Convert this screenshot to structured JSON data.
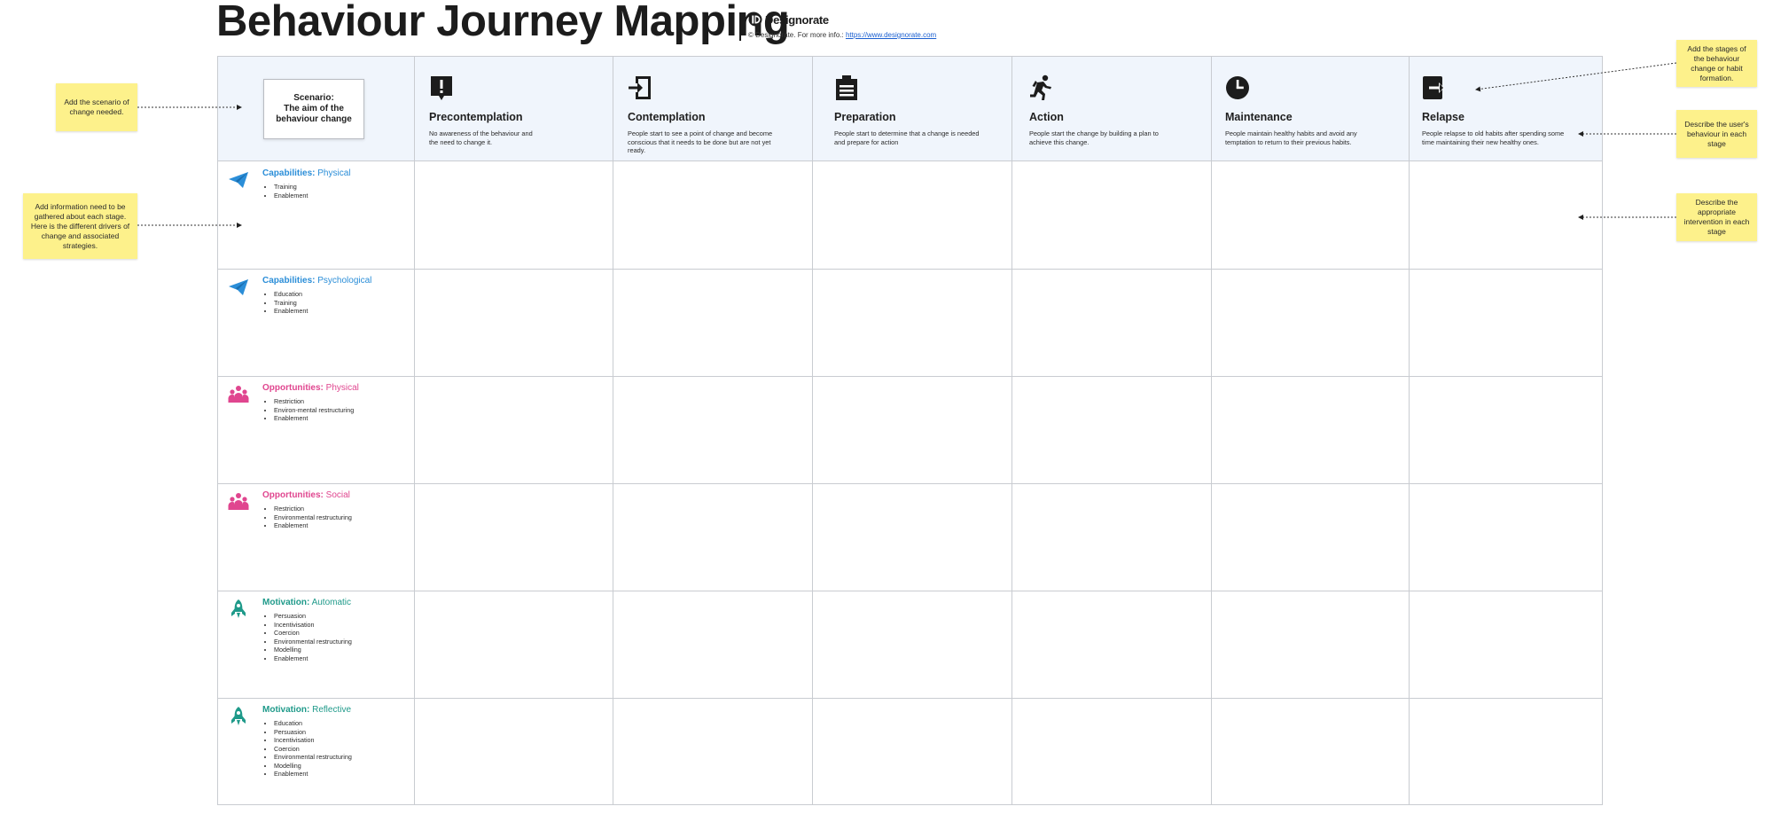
{
  "header": {
    "title": "Behaviour Journey Mapping",
    "brand_name": "Designorate",
    "copyright_text": "© Designorate. For more info.: ",
    "copyright_link": "https://www.designorate.com"
  },
  "scenario": {
    "label": "Scenario:",
    "text": "The aim of the behaviour change"
  },
  "stages": [
    {
      "name": "Precontemplation",
      "icon": "exclamation-bubble-icon",
      "description": "No awareness of the behaviour and the need to change it."
    },
    {
      "name": "Contemplation",
      "icon": "sign-in-icon",
      "description": "People start to see a point of change and become conscious that it needs to be done but are not yet ready."
    },
    {
      "name": "Preparation",
      "icon": "clipboard-icon",
      "description": "People start to determine that a change is needed and prepare for action"
    },
    {
      "name": "Action",
      "icon": "running-person-icon",
      "description": "People start the change by building a plan to achieve this change."
    },
    {
      "name": "Maintenance",
      "icon": "clock-icon",
      "description": "People maintain healthy habits and avoid any temptation to return to their previous habits."
    },
    {
      "name": "Relapse",
      "icon": "sign-out-icon",
      "description": "People relapse to old habits after spending some time maintaining their new healthy ones."
    }
  ],
  "rows": [
    {
      "category": "Capabilities:",
      "type": "Physical",
      "icon": "paper-plane-icon",
      "color": "#2b8ed8",
      "items": [
        "Training",
        "Enablement"
      ]
    },
    {
      "category": "Capabilities:",
      "type": "Psychological",
      "icon": "paper-plane-icon",
      "color": "#2b8ed8",
      "items": [
        "Education",
        "Training",
        "Enablement"
      ]
    },
    {
      "category": "Opportunities:",
      "type": "Physical",
      "icon": "people-group-icon",
      "color": "#e0468f",
      "items": [
        "Restriction",
        "Environ-mental restructuring",
        "Enablement"
      ]
    },
    {
      "category": "Opportunities:",
      "type": "Social",
      "icon": "people-group-icon",
      "color": "#e0468f",
      "items": [
        "Restriction",
        "Environmental restructuring",
        "Enablement"
      ]
    },
    {
      "category": "Motivation:",
      "type": "Automatic",
      "icon": "rocket-icon",
      "color": "#1f9a8a",
      "items": [
        "Persuasion",
        "Incentivisation",
        "Coercion",
        "Environmental restructuring",
        "Modelling",
        "Enablement"
      ]
    },
    {
      "category": "Motivation:",
      "type": "Reflective",
      "icon": "rocket-icon",
      "color": "#1f9a8a",
      "items": [
        "Education",
        "Persuasion",
        "Incentivisation",
        "Coercion",
        "Environmental restructuring",
        "Modelling",
        "Enablement"
      ]
    }
  ],
  "sticky_notes": {
    "scenario": "Add the scenario of change needed.",
    "information": "Add information need to be gathered about each stage. Here is the different drivers of change and associated strategies.",
    "stages": "Add the stages of the behaviour change or habit formation.",
    "behaviour": "Describe the user's behaviour in each stage",
    "intervention": "Describe the appropriate intervention in each stage"
  },
  "colors": {
    "header_band": "#f0f5fc",
    "sticky": "#fdf18b",
    "grid_line": "#c9ccd1"
  }
}
